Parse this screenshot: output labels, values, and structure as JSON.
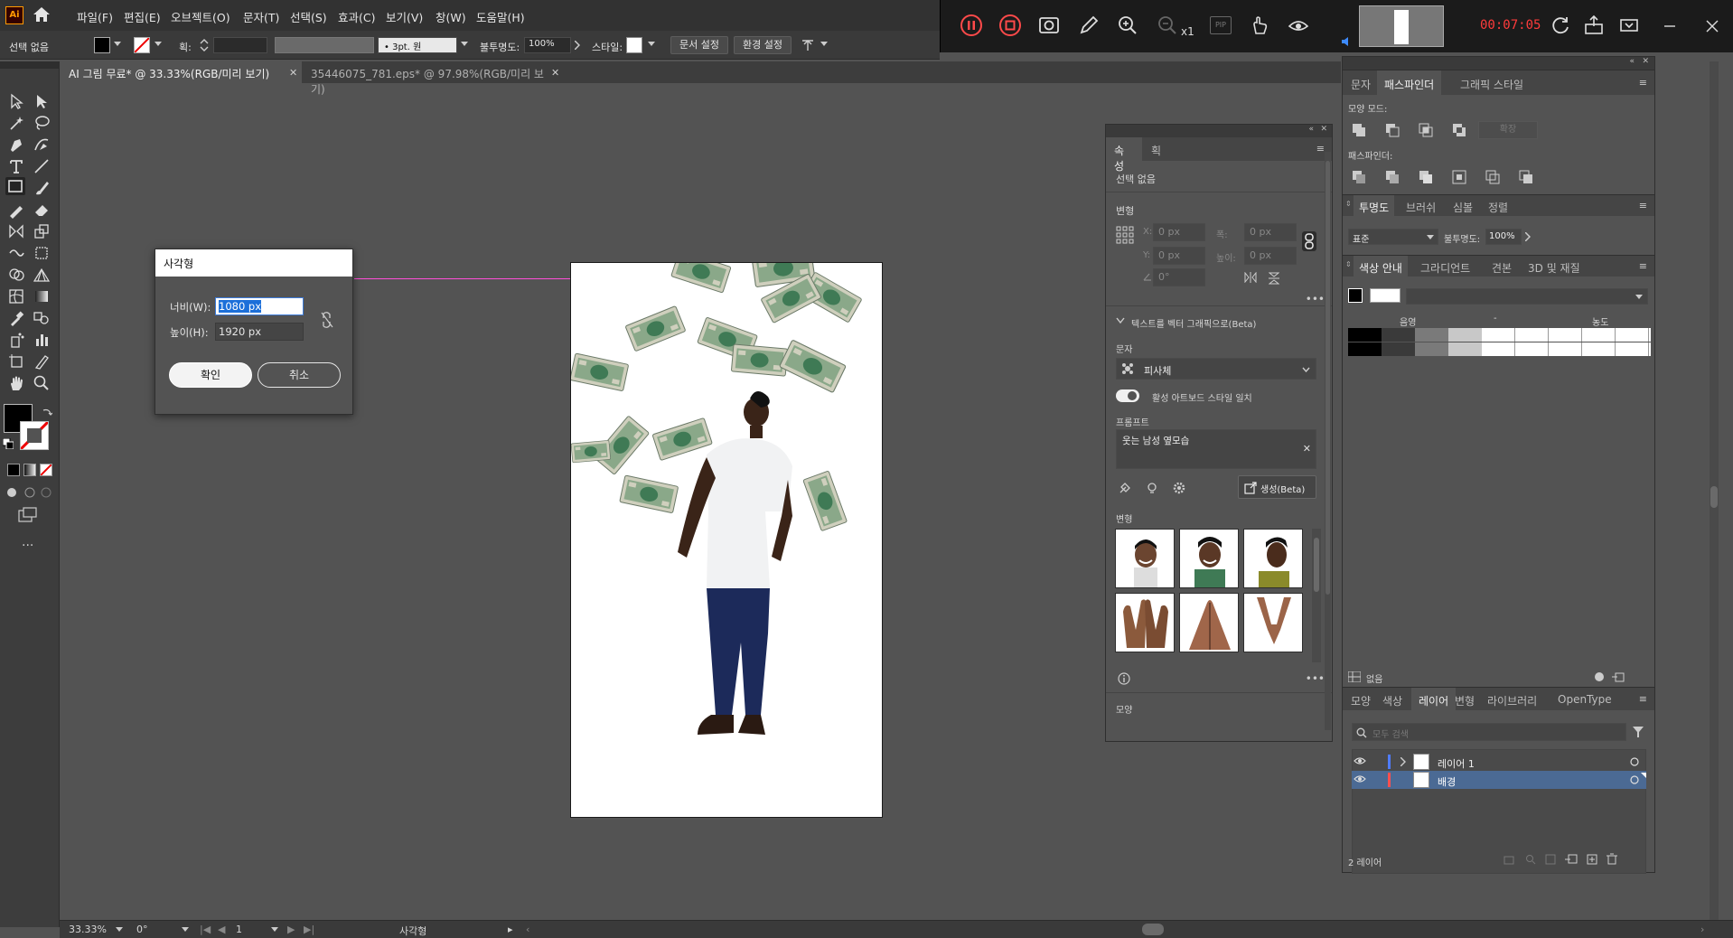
{
  "app": {
    "logo": "Ai"
  },
  "menu": {
    "items": [
      "파일(F)",
      "편집(E)",
      "오브젝트(O)",
      "문자(T)",
      "선택(S)",
      "효과(C)",
      "보기(V)",
      "창(W)",
      "도움말(H)"
    ]
  },
  "recorder": {
    "timer": "00:07:05",
    "zoom_suffix": "x1",
    "pip": "PIP"
  },
  "control_bar": {
    "selection_label": "선택 없음",
    "stroke_label": "획:",
    "brush_label": "3pt. 원",
    "opacity_label": "불투명도:",
    "opacity_value": "100%",
    "style_label": "스타일:",
    "doc_setup_btn": "문서 설정",
    "prefs_btn": "환경 설정"
  },
  "tabs": [
    {
      "label": "AI 그림 무료* @ 33.33%(RGB/미리 보기)",
      "active": true
    },
    {
      "label": "35446075_781.eps* @ 97.98%(RGB/미리 보기)",
      "active": false
    }
  ],
  "dialog": {
    "title": "사각형",
    "width_label": "너비(W):",
    "width_value": "1080 px",
    "height_label": "높이(H):",
    "height_value": "1920 px",
    "ok_label": "확인",
    "cancel_label": "취소"
  },
  "properties": {
    "tabs": [
      "속성",
      "획"
    ],
    "no_selection": "선택 없음",
    "transform_title": "변형",
    "x_label": "X:",
    "x_value": "0 px",
    "y_label": "Y:",
    "y_value": "0 px",
    "w_label": "폭:",
    "w_value": "0 px",
    "h_label": "높이:",
    "h_value": "0 px",
    "angle_value": "0°",
    "text_to_vector": "텍스트를 벡터 그래픽으로(Beta)",
    "type_label": "문자",
    "type_value": "피사체",
    "match_style": "활성 아트보드 스타일 일치",
    "prompt_label": "프롬프트",
    "prompt_value": "웃는 남성 옆모습",
    "generate_btn": "생성(Beta)",
    "variations_title": "변형",
    "appearance_title": "모양"
  },
  "pathfinder_panel": {
    "tabs": [
      "문자",
      "패스파인더",
      "그래픽 스타일"
    ],
    "shape_modes": "모양 모드:",
    "expand_btn": "확장",
    "pathfinders": "패스파인더:"
  },
  "transparency_panel": {
    "tabs": [
      "투명도",
      "브러쉬",
      "심볼",
      "정렬"
    ],
    "blend_mode": "표준",
    "opacity_label": "불투명도:",
    "opacity_value": "100%"
  },
  "color_guide_panel": {
    "tabs": [
      "색상 안내",
      "그라디언트",
      "견본",
      "3D 및 재질"
    ],
    "shade_label": "음영",
    "tint_label": "농도",
    "footer_label": "없음",
    "swatches": [
      "#000000",
      "#3a3a3a",
      "#7a7a7a",
      "#c8c8c8",
      "#ffffff",
      "#ffffff",
      "#ffffff",
      "#ffffff",
      "#ffffff"
    ]
  },
  "layers_panel": {
    "tabs": [
      "모양",
      "색상",
      "레이어",
      "변형",
      "라이브러리",
      "OpenType"
    ],
    "search_placeholder": "모두 검색",
    "layers": [
      {
        "name": "레이어 1",
        "color": "#4f7cff"
      },
      {
        "name": "배경",
        "color": "#ff4f4f"
      }
    ],
    "count": "2 레이어"
  },
  "status_bar": {
    "zoom": "33.33%",
    "rotation": "0°",
    "artboard_num": "1",
    "tool_name": "사각형"
  },
  "colors": {
    "accent": "#1c6fd9",
    "smart_guide": "#ff4fd8",
    "recording_red": "#ff3b3b"
  }
}
